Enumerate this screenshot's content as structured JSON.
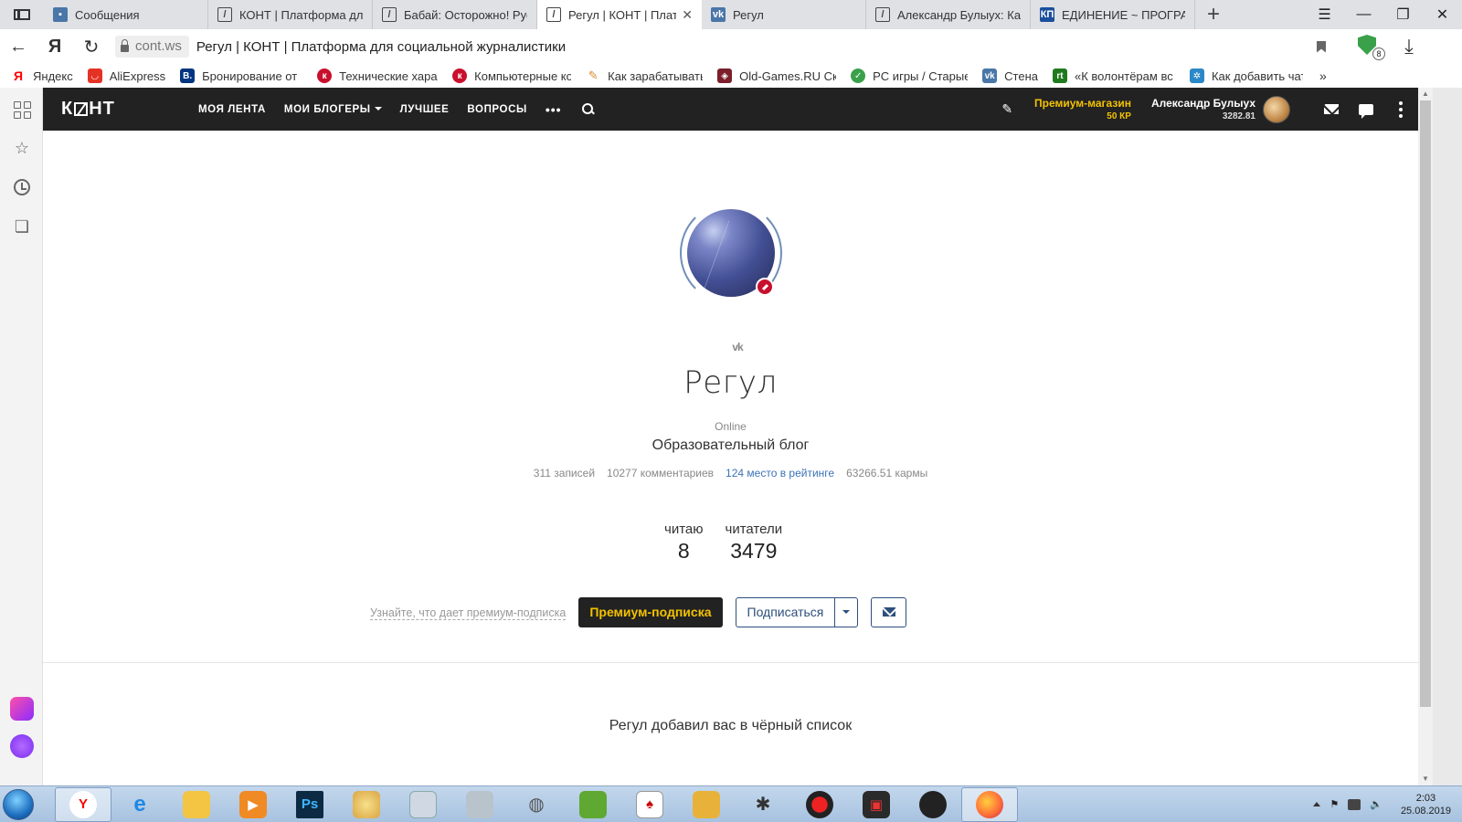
{
  "browser": {
    "tabs": [
      {
        "title": "Сообщения",
        "icon": "vk-messages-icon",
        "active": false
      },
      {
        "title": "КОНТ | Платформа для с",
        "icon": "kont-icon",
        "active": false
      },
      {
        "title": "Бабай: Осторожно! Русс",
        "icon": "kont-icon",
        "active": false
      },
      {
        "title": "Регул | КОНТ | Платфо",
        "icon": "kont-icon",
        "active": true
      },
      {
        "title": "Регул",
        "icon": "vk-icon",
        "active": false
      },
      {
        "title": "Александр Булыух: Как",
        "icon": "kont-icon",
        "active": false
      },
      {
        "title": "ЕДИНЕНИЕ ~ ПРОГРАМ",
        "icon": "kp-icon",
        "active": false
      }
    ],
    "address": {
      "domain": "cont.ws",
      "title": "Регул | КОНТ | Платформа для социальной журналистики"
    },
    "protect_badge": "8",
    "bookmarks": [
      {
        "label": "Яндекс",
        "color": "#ff0000"
      },
      {
        "label": "AliExpress",
        "color": "#e43225"
      },
      {
        "label": "Бронирование от",
        "color": "#003580"
      },
      {
        "label": "Технические хара",
        "color": "#c8102e"
      },
      {
        "label": "Компьютерные ко",
        "color": "#c8102e"
      },
      {
        "label": "Как зарабатывать",
        "color": "#d98b2b"
      },
      {
        "label": "Old-Games.RU Ска",
        "color": "#7a1f2b"
      },
      {
        "label": "PC игры / Старые",
        "color": "#3aa14a"
      },
      {
        "label": "Стена",
        "color": "#4a76a8"
      },
      {
        "label": "«К волонтёрам вс",
        "color": "#1f7a1f"
      },
      {
        "label": "Как добавить чат",
        "color": "#2a88c8"
      }
    ],
    "bookmarks_more": "»"
  },
  "site": {
    "logo": "К Н Т",
    "nav": {
      "my_feed": "МОЯ ЛЕНТА",
      "my_bloggers": "МОИ БЛОГЕРЫ",
      "best": "ЛУЧШЕЕ",
      "questions": "ВОПРОСЫ",
      "more": "•••"
    },
    "premium_shop": {
      "label": "Премиум-магазин",
      "balance": "50 КР"
    },
    "user": {
      "name": "Александр Булыух",
      "karma": "3282.81"
    }
  },
  "profile": {
    "name": "Регул",
    "status": "Online",
    "description": "Образовательный блог",
    "stats": {
      "posts": "311 записей",
      "comments": "10277 комментариев",
      "rating": "124 место в рейтинге",
      "karma": "63266.51 кармы"
    },
    "following": {
      "label": "читаю",
      "value": "8"
    },
    "followers": {
      "label": "читатели",
      "value": "3479"
    },
    "learn_premium": "Узнайте, что дает премиум-подписка",
    "premium_button": "Премиум-подписка",
    "subscribe_button": "Подписаться",
    "blacklist_notice": "Регул добавил вас в чёрный список"
  },
  "taskbar": {
    "time": "2:03",
    "date": "25.08.2019",
    "apps": [
      "yandex-browser",
      "internet-explorer",
      "explorer",
      "media-player",
      "photoshop",
      "paint",
      "calculator",
      "scanner",
      "gamepad",
      "game-green",
      "solitaire",
      "game-king",
      "spider",
      "record",
      "video-editor",
      "obs",
      "firefox"
    ]
  }
}
